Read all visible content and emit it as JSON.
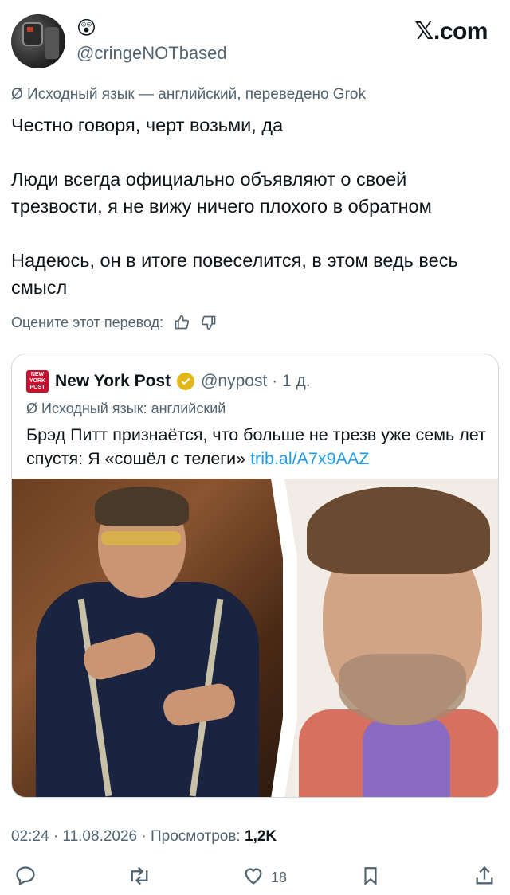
{
  "header": {
    "display_emoji": "😲",
    "handle": "@cringeNOTbased",
    "brand": "𝕏.com"
  },
  "translation": {
    "note": "Ø Исходный язык — английский, переведено Grok"
  },
  "tweet": {
    "lines": [
      "Честно говоря, черт возьми, да",
      "Люди всегда официально объявляют о своей трезвости, я не вижу ничего плохого в обратном",
      "Надеюсь, он в итоге повеселится, в этом ведь весь смысл"
    ]
  },
  "rate": {
    "label": "Оцените этот перевод:"
  },
  "quote": {
    "logo_lines": [
      "NEW",
      "YORK",
      "POST"
    ],
    "name": "New York Post",
    "handle_time": "@nypost · 1 д.",
    "lang_note": "Ø Исходный язык: английский",
    "text": "Брэд Питт признаётся, что больше не трезв уже семь лет спустя: Я «сошёл с телеги» ",
    "link": "trib.al/A7x9AAZ"
  },
  "meta": {
    "time_date": "02:24 · 11.08.2026 · Просмотров: ",
    "views": "1,2K"
  },
  "actions": {
    "likes": "18"
  },
  "colors": {
    "text": "#0f1419",
    "secondary": "#536471",
    "link": "#1d9bf0",
    "border": "#cfd9de",
    "verified": "#e2b719",
    "nyp_red": "#c8102e"
  }
}
